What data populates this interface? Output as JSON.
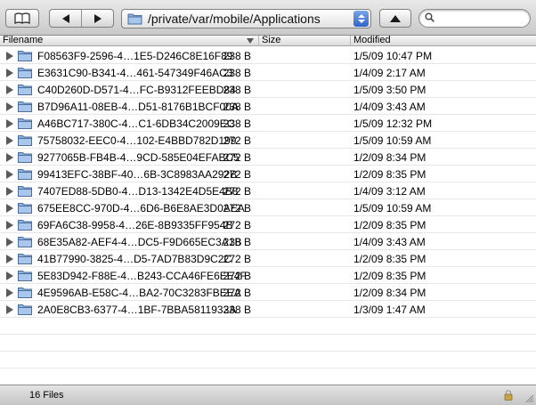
{
  "toolbar": {
    "path": "/private/var/mobile/Applications",
    "search_placeholder": "",
    "icons": {
      "book": "open-book-icon",
      "back": "back-arrow-icon",
      "forward": "forward-arrow-icon",
      "folder": "folder-icon",
      "popup": "popup-arrows-icon",
      "eject": "eject-icon",
      "search": "search-icon"
    }
  },
  "columns": {
    "filename": "Filename",
    "size": "Size",
    "modified": "Modified"
  },
  "rows": [
    {
      "name": "F08563F9-2596-4…1E5-D246C8E16F89",
      "size": "238 B",
      "modified": "1/5/09 10:47 PM"
    },
    {
      "name": "E3631C90-B341-4…461-547349F46AC3",
      "size": "238 B",
      "modified": "1/4/09 2:17 AM"
    },
    {
      "name": "C40D260D-D571-4…FC-B9312FEEBD84",
      "size": "238 B",
      "modified": "1/5/09 3:50 PM"
    },
    {
      "name": "B7D96A11-08EB-4…D51-8176B1BCF00A",
      "size": "238 B",
      "modified": "1/4/09 3:43 AM"
    },
    {
      "name": "A46BC717-380C-4…C1-6DB34C2009EC",
      "size": "238 B",
      "modified": "1/5/09 12:32 PM"
    },
    {
      "name": "75758032-EEC0-4…102-E4BBD782D199",
      "size": "272 B",
      "modified": "1/5/09 10:59 AM"
    },
    {
      "name": "9277065B-FB4B-4…9CD-585E04EFABC5",
      "size": "272 B",
      "modified": "1/2/09 8:34 PM"
    },
    {
      "name": "99413EFC-38BF-40…6B-3C8983AA292B",
      "size": "272 B",
      "modified": "1/2/09 8:35 PM"
    },
    {
      "name": "7407ED88-5DB0-4…D13-1342E4D5E4B8",
      "size": "272 B",
      "modified": "1/4/09 3:12 AM"
    },
    {
      "name": "675EE8CC-970D-4…6D6-B6E8AE3D0AEA",
      "size": "272 B",
      "modified": "1/5/09 10:59 AM"
    },
    {
      "name": "69FA6C38-9958-4…26E-8B9335FF954B",
      "size": "272 B",
      "modified": "1/2/09 8:35 PM"
    },
    {
      "name": "68E35A82-AEF4-4…DC5-F9D665EC3A1B",
      "size": "238 B",
      "modified": "1/4/09 3:43 AM"
    },
    {
      "name": "41B77990-3825-4…D5-7AD7B83D9C2C",
      "size": "272 B",
      "modified": "1/2/09 8:35 PM"
    },
    {
      "name": "5E83D942-F88E-4…B243-CCA46FE6EE4F",
      "size": "272 B",
      "modified": "1/2/09 8:35 PM"
    },
    {
      "name": "4E9596AB-E58C-4…BA2-70C3283FBEEA",
      "size": "272 B",
      "modified": "1/2/09 8:34 PM"
    },
    {
      "name": "2A0E8CB3-6377-4…1BF-7BBA5811933A",
      "size": "238 B",
      "modified": "1/3/09 1:47 AM"
    }
  ],
  "status": {
    "count_text": "16 Files",
    "lock_icon": "lock-icon"
  },
  "colors": {
    "folder_blue": "#8fb3e0",
    "popup_accent": "#2d64c8"
  }
}
